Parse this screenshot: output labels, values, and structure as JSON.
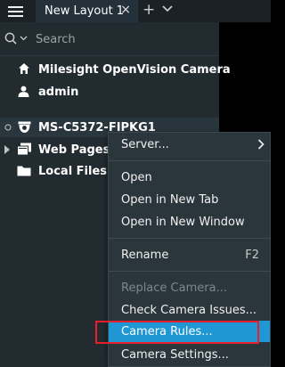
{
  "header": {
    "tab_label": "New Layout 1",
    "tab_close": "×",
    "tab_add": "+"
  },
  "search": {
    "placeholder": "Search"
  },
  "tree": {
    "server": "Milesight OpenVision Camera",
    "user": "admin",
    "camera": "MS-C5372-FIPKG1",
    "web_pages": "Web Pages",
    "local_files": "Local Files"
  },
  "context_menu": {
    "server": "Server...",
    "open": "Open",
    "open_new_tab": "Open in New Tab",
    "open_new_window": "Open in New Window",
    "rename": "Rename",
    "rename_shortcut": "F2",
    "replace_camera": "Replace Camera...",
    "check_issues": "Check Camera Issues...",
    "camera_rules": "Camera Rules...",
    "camera_settings": "Camera Settings..."
  },
  "colors": {
    "highlight": "#1f97d4",
    "annotation_box": "#e5202e",
    "panel_bg": "#222b30",
    "menu_bg": "#2b363c"
  }
}
